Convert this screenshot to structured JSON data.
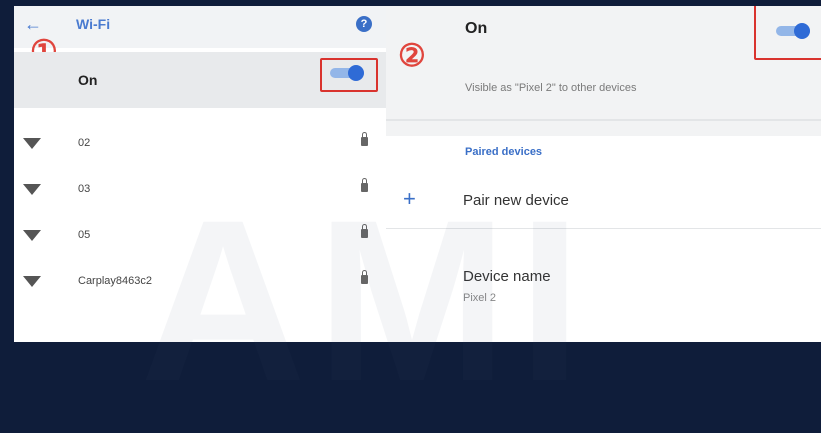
{
  "left_panel": {
    "header": {
      "back_icon": "arrow-left-icon",
      "title": "Wi-Fi",
      "help_icon": "help-icon",
      "help_glyph": "?"
    },
    "step_number": "①",
    "toggle": {
      "label": "On",
      "state": "on"
    },
    "networks": [
      {
        "name": "02",
        "icon": "wifi-icon",
        "lock_icon": "lock-icon"
      },
      {
        "name": "03",
        "icon": "wifi-icon",
        "lock_icon": "lock-icon"
      },
      {
        "name": "05",
        "icon": "wifi-icon",
        "lock_icon": "lock-icon"
      },
      {
        "name": "Carplay8463c2",
        "icon": "wifi-icon",
        "lock_icon": "lock-icon"
      }
    ]
  },
  "right_panel": {
    "step_number": "②",
    "toggle": {
      "label": "On",
      "state": "on"
    },
    "visibility_text": "Visible as \"Pixel 2\" to other devices",
    "paired_header": "Paired devices",
    "pair_new": {
      "icon": "plus-icon",
      "glyph": "+",
      "label": "Pair new device"
    },
    "device_name": {
      "label": "Device name",
      "value": "Pixel 2"
    }
  },
  "watermark_text": "AMI",
  "colors": {
    "accent": "#2f6bd6",
    "highlight_box": "#d9332e",
    "step_number": "#e0453d",
    "frame": "#0f1d3a"
  }
}
